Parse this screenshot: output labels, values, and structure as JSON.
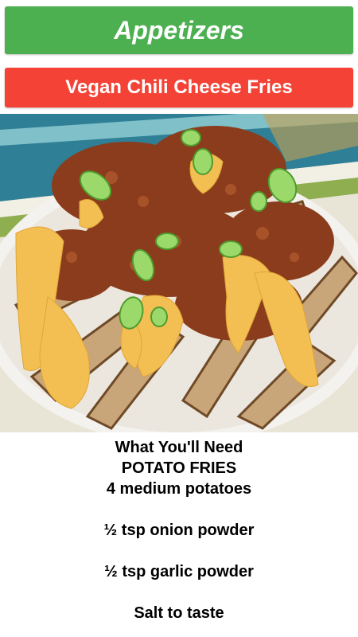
{
  "header": {
    "category": "Appetizers",
    "recipe_title": "Vegan Chili Cheese Fries"
  },
  "colors": {
    "category_bg": "#4caf50",
    "title_bg": "#f44336"
  },
  "image": {
    "icon": "food-photo"
  },
  "ingredients": {
    "heading": "What You'll Need",
    "section": "POTATO FRIES",
    "item_1": "4 medium potatoes",
    "item_2": "½ tsp onion powder",
    "item_3": "½ tsp garlic powder",
    "item_4": "Salt to taste"
  }
}
